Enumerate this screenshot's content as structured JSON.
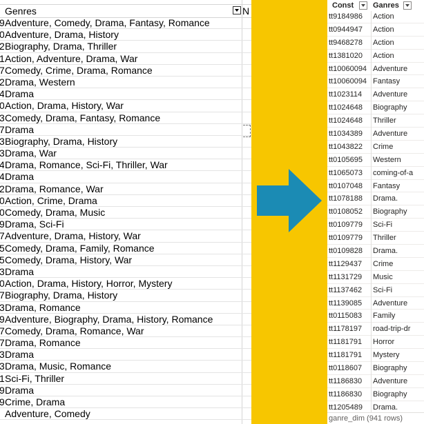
{
  "excel": {
    "header": "Genres",
    "next_col_partial": "N",
    "rows": [
      {
        "rn": "9",
        "genres": "Adventure, Comedy, Drama, Fantasy, Romance"
      },
      {
        "rn": "0",
        "genres": "Adventure, Drama, History"
      },
      {
        "rn": "2",
        "genres": "Biography, Drama, Thriller"
      },
      {
        "rn": "1",
        "genres": "Action, Adventure, Drama, War"
      },
      {
        "rn": "7",
        "genres": "Comedy, Crime, Drama, Romance"
      },
      {
        "rn": "2",
        "genres": "Drama, Western"
      },
      {
        "rn": "4",
        "genres": "Drama"
      },
      {
        "rn": "0",
        "genres": "Action, Drama, History, War"
      },
      {
        "rn": "3",
        "genres": "Comedy, Drama, Fantasy, Romance"
      },
      {
        "rn": "7",
        "genres": "Drama"
      },
      {
        "rn": "3",
        "genres": "Biography, Drama, History"
      },
      {
        "rn": "3",
        "genres": "Drama, War"
      },
      {
        "rn": "4",
        "genres": "Drama, Romance, Sci-Fi, Thriller, War"
      },
      {
        "rn": "4",
        "genres": "Drama"
      },
      {
        "rn": "2",
        "genres": "Drama, Romance, War"
      },
      {
        "rn": "0",
        "genres": "Action, Crime, Drama"
      },
      {
        "rn": "0",
        "genres": "Comedy, Drama, Music"
      },
      {
        "rn": "9",
        "genres": "Drama, Sci-Fi"
      },
      {
        "rn": "7",
        "genres": "Adventure, Drama, History, War"
      },
      {
        "rn": "5",
        "genres": "Comedy, Drama, Family, Romance"
      },
      {
        "rn": "5",
        "genres": "Comedy, Drama, History, War"
      },
      {
        "rn": "3",
        "genres": "Drama"
      },
      {
        "rn": "0",
        "genres": "Action, Drama, History, Horror, Mystery"
      },
      {
        "rn": "7",
        "genres": "Biography, Drama, History"
      },
      {
        "rn": "3",
        "genres": "Drama, Romance"
      },
      {
        "rn": "9",
        "genres": "Adventure, Biography, Drama, History, Romance"
      },
      {
        "rn": "7",
        "genres": "Comedy, Drama, Romance, War"
      },
      {
        "rn": "7",
        "genres": "Drama, Romance"
      },
      {
        "rn": "3",
        "genres": "Drama"
      },
      {
        "rn": "3",
        "genres": "Drama, Music, Romance"
      },
      {
        "rn": "1",
        "genres": "Sci-Fi, Thriller"
      },
      {
        "rn": "9",
        "genres": "Drama"
      },
      {
        "rn": "9",
        "genres": "Crime, Drama"
      },
      {
        "rn": "",
        "genres": "Adventure, Comedy"
      }
    ]
  },
  "powerbi": {
    "col_const": "Const",
    "col_genres": "Ganres",
    "rows": [
      {
        "const": "tt9184986",
        "genre": "Action"
      },
      {
        "const": "tt0944947",
        "genre": "Action"
      },
      {
        "const": "tt9468278",
        "genre": "Action"
      },
      {
        "const": "tt1381020",
        "genre": "Action"
      },
      {
        "const": "tt10060094",
        "genre": "Adventure"
      },
      {
        "const": "tt10060094",
        "genre": "Fantasy"
      },
      {
        "const": "tt1023114",
        "genre": "Adventure"
      },
      {
        "const": "tt1024648",
        "genre": "Biography"
      },
      {
        "const": "tt1024648",
        "genre": "Thriller"
      },
      {
        "const": "tt1034389",
        "genre": "Adventure"
      },
      {
        "const": "tt1043822",
        "genre": "Crime"
      },
      {
        "const": "tt0105695",
        "genre": "Western"
      },
      {
        "const": "tt1065073",
        "genre": "coming-of-a"
      },
      {
        "const": "tt0107048",
        "genre": "Fantasy"
      },
      {
        "const": "tt1078188",
        "genre": "Drama."
      },
      {
        "const": "tt0108052",
        "genre": "Biography"
      },
      {
        "const": "tt0109779",
        "genre": "Sci-Fi"
      },
      {
        "const": "tt0109779",
        "genre": "Thriller"
      },
      {
        "const": "tt0109828",
        "genre": "Drama."
      },
      {
        "const": "tt1129437",
        "genre": "Crime"
      },
      {
        "const": "tt1131729",
        "genre": "Music"
      },
      {
        "const": "tt1137462",
        "genre": "Sci-Fi"
      },
      {
        "const": "tt1139085",
        "genre": "Adventure"
      },
      {
        "const": "tt0115083",
        "genre": "Family"
      },
      {
        "const": "tt1178197",
        "genre": "road-trip-dr"
      },
      {
        "const": "tt1181791",
        "genre": "Horror"
      },
      {
        "const": "tt1181791",
        "genre": "Mystery"
      },
      {
        "const": "tt0118607",
        "genre": "Biography"
      },
      {
        "const": "tt1186830",
        "genre": "Adventure"
      },
      {
        "const": "tt1186830",
        "genre": "Biography"
      },
      {
        "const": "tt1205489",
        "genre": "Drama."
      }
    ],
    "footer": "ganre_dim (941 rows)"
  },
  "colors": {
    "band": "#f7c600",
    "arrow": "#1b8bb4"
  },
  "icons": [
    "filter-dropdown-icon",
    "right-arrow-icon",
    "column-dropdown-icon"
  ]
}
